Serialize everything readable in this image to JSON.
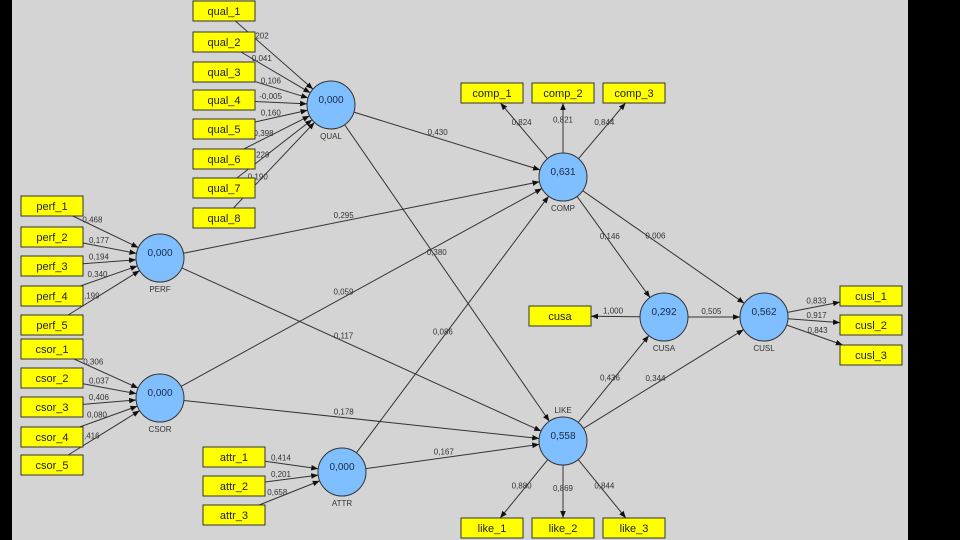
{
  "colors": {
    "latent_fill": "#7fbfff",
    "indicator_fill": "#ffff00",
    "background": "#d4d4d4"
  },
  "latents": [
    {
      "id": "QUAL",
      "name": "QUAL",
      "value": "0,000"
    },
    {
      "id": "COMP",
      "name": "COMP",
      "value": "0,631"
    },
    {
      "id": "PERF",
      "name": "PERF",
      "value": "0,000"
    },
    {
      "id": "CSOR",
      "name": "CSOR",
      "value": "0,000"
    },
    {
      "id": "ATTR",
      "name": "ATTR",
      "value": "0,000"
    },
    {
      "id": "LIKE",
      "name": "LIKE",
      "value": "0,558"
    },
    {
      "id": "CUSA",
      "name": "CUSA",
      "value": "0,292"
    },
    {
      "id": "CUSL",
      "name": "CUSL",
      "value": "0,562"
    }
  ],
  "indicators": [
    {
      "id": "qual_1",
      "latent": "QUAL",
      "mode": "formative",
      "weight": "0,202"
    },
    {
      "id": "qual_2",
      "latent": "QUAL",
      "mode": "formative",
      "weight": "0,041"
    },
    {
      "id": "qual_3",
      "latent": "QUAL",
      "mode": "formative",
      "weight": "0,106"
    },
    {
      "id": "qual_4",
      "latent": "QUAL",
      "mode": "formative",
      "weight": "-0,005"
    },
    {
      "id": "qual_5",
      "latent": "QUAL",
      "mode": "formative",
      "weight": "0,160"
    },
    {
      "id": "qual_6",
      "latent": "QUAL",
      "mode": "formative",
      "weight": "0,398"
    },
    {
      "id": "qual_7",
      "latent": "QUAL",
      "mode": "formative",
      "weight": "0,229"
    },
    {
      "id": "qual_8",
      "latent": "QUAL",
      "mode": "formative",
      "weight": "0,190"
    },
    {
      "id": "perf_1",
      "latent": "PERF",
      "mode": "formative",
      "weight": "0,468"
    },
    {
      "id": "perf_2",
      "latent": "PERF",
      "mode": "formative",
      "weight": "0,177"
    },
    {
      "id": "perf_3",
      "latent": "PERF",
      "mode": "formative",
      "weight": "0,194"
    },
    {
      "id": "perf_4",
      "latent": "PERF",
      "mode": "formative",
      "weight": "0,340"
    },
    {
      "id": "perf_5",
      "latent": "PERF",
      "mode": "formative",
      "weight": "0,199"
    },
    {
      "id": "csor_1",
      "latent": "CSOR",
      "mode": "formative",
      "weight": "0,306"
    },
    {
      "id": "csor_2",
      "latent": "CSOR",
      "mode": "formative",
      "weight": "0,037"
    },
    {
      "id": "csor_3",
      "latent": "CSOR",
      "mode": "formative",
      "weight": "0,406"
    },
    {
      "id": "csor_4",
      "latent": "CSOR",
      "mode": "formative",
      "weight": "0,080"
    },
    {
      "id": "csor_5",
      "latent": "CSOR",
      "mode": "formative",
      "weight": "0,416"
    },
    {
      "id": "attr_1",
      "latent": "ATTR",
      "mode": "formative",
      "weight": "0,414"
    },
    {
      "id": "attr_2",
      "latent": "ATTR",
      "mode": "formative",
      "weight": "0,201"
    },
    {
      "id": "attr_3",
      "latent": "ATTR",
      "mode": "formative",
      "weight": "0,658"
    },
    {
      "id": "comp_1",
      "latent": "COMP",
      "mode": "reflective",
      "weight": "0,824"
    },
    {
      "id": "comp_2",
      "latent": "COMP",
      "mode": "reflective",
      "weight": "0,821"
    },
    {
      "id": "comp_3",
      "latent": "COMP",
      "mode": "reflective",
      "weight": "0,844"
    },
    {
      "id": "like_1",
      "latent": "LIKE",
      "mode": "reflective",
      "weight": "0,880"
    },
    {
      "id": "like_2",
      "latent": "LIKE",
      "mode": "reflective",
      "weight": "0,869"
    },
    {
      "id": "like_3",
      "latent": "LIKE",
      "mode": "reflective",
      "weight": "0,844"
    },
    {
      "id": "cusa",
      "latent": "CUSA",
      "mode": "reflective",
      "weight": "1,000"
    },
    {
      "id": "cusl_1",
      "latent": "CUSL",
      "mode": "reflective",
      "weight": "0,833"
    },
    {
      "id": "cusl_2",
      "latent": "CUSL",
      "mode": "reflective",
      "weight": "0,917"
    },
    {
      "id": "cusl_3",
      "latent": "CUSL",
      "mode": "reflective",
      "weight": "0,843"
    }
  ],
  "paths": [
    {
      "from": "QUAL",
      "to": "COMP",
      "coef": "0,430"
    },
    {
      "from": "QUAL",
      "to": "LIKE",
      "coef": "0,380"
    },
    {
      "from": "PERF",
      "to": "COMP",
      "coef": "0,295"
    },
    {
      "from": "PERF",
      "to": "LIKE",
      "coef": "0,117"
    },
    {
      "from": "CSOR",
      "to": "COMP",
      "coef": "0,059"
    },
    {
      "from": "CSOR",
      "to": "LIKE",
      "coef": "0,178"
    },
    {
      "from": "ATTR",
      "to": "COMP",
      "coef": "0,086"
    },
    {
      "from": "ATTR",
      "to": "LIKE",
      "coef": "0,167"
    },
    {
      "from": "COMP",
      "to": "CUSA",
      "coef": "0,146"
    },
    {
      "from": "COMP",
      "to": "CUSL",
      "coef": "0,006"
    },
    {
      "from": "LIKE",
      "to": "CUSA",
      "coef": "0,436"
    },
    {
      "from": "LIKE",
      "to": "CUSL",
      "coef": "0,344"
    },
    {
      "from": "CUSA",
      "to": "CUSL",
      "coef": "0,505"
    }
  ]
}
